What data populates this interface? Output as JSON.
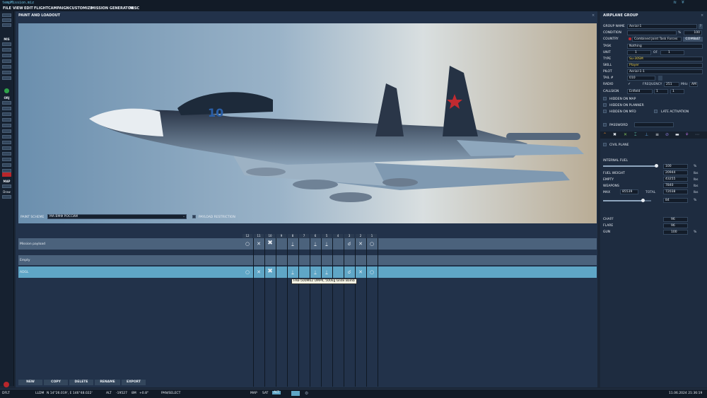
{
  "window": {
    "title": "tempMission.miz"
  },
  "menu": [
    "FILE",
    "VIEW",
    "EDIT",
    "FLIGHT",
    "CAMPAIGN",
    "CUSTOMIZE",
    "MISSION GENERATOR",
    "MISC"
  ],
  "left_toolbar": {
    "labels": [
      "MIS",
      "ORJ",
      "MAP"
    ],
    "map_buttons": [
      "Draw"
    ]
  },
  "loadout_panel": {
    "title": "PAINT AND LOADOUT",
    "paint_scheme_label": "PAINT SCHEME",
    "paint_scheme_value": "МА ВМФ РОССИИ",
    "payload_restriction_label": "PAYLOAD RESTRICTION",
    "stations": [
      "12",
      "11",
      "10",
      "9",
      "8",
      "7",
      "6",
      "5",
      "4",
      "3",
      "2",
      "1"
    ],
    "rows": [
      {
        "name": "Mission payload",
        "selected": false
      },
      {
        "name": "Empty",
        "selected": false
      },
      {
        "name": "ADGL",
        "selected": true
      }
    ],
    "tooltip": "FAB-500M62 UMPK, 500kg Glide Bomb",
    "buttons": [
      "NEW",
      "COPY",
      "DELETE",
      "RENAME",
      "EXPORT"
    ]
  },
  "group_panel": {
    "title": "AIRPLANE GROUP",
    "group_name_label": "GROUP NAME",
    "group_name": "Aerial-1",
    "condition_label": "CONDITION",
    "condition_value": "100",
    "country_label": "COUNTRY",
    "country": "Combined Joint Task Forces",
    "combat_btn": "COMBAT",
    "task_label": "TASK",
    "task": "Nothing",
    "unit_label": "UNIT",
    "unit": "1",
    "of_label": "OF",
    "of_value": "1",
    "type_label": "TYPE",
    "type": "Su-30SM",
    "skill_label": "SKILL",
    "skill": "Player",
    "pilot_label": "PILOT",
    "pilot": "Aerial-1-1",
    "tail_label": "TAIL #",
    "tail": "010",
    "radio_label": "RADIO",
    "frequency_label": "FREQUENCY",
    "frequency": "251",
    "mhz": "MHz",
    "am": "AM",
    "callsign_label": "CALLSIGN",
    "callsign": "Enfield",
    "callsign_n1": "1",
    "callsign_n2": "1",
    "hidden_map": "HIDDEN ON MAP",
    "hidden_planner": "HIDDEN ON PLANNER",
    "hidden_mfd": "HIDDEN ON MFD",
    "late_activation": "LATE ACTIVATION",
    "password_label": "PASSWORD",
    "civil_plane": "CIVIL PLANE",
    "internal_fuel_label": "INTERNAL FUEL",
    "internal_fuel": "100",
    "pct": "%",
    "fuel_weight_label": "FUEL WEIGHT",
    "fuel_weight": "20944",
    "empty_label": "EMPTY",
    "empty": "43255",
    "weapons_label": "WEAPONS",
    "weapons": "7840",
    "max_label": "MAX",
    "max": "85539",
    "total_label": "TOTAL",
    "total": "72038",
    "slider2_value": "84",
    "lbs": "lbs",
    "chaff_label": "CHAFF",
    "chaff": "96",
    "flare_label": "FLARE",
    "flare": "96",
    "gun_label": "GUN",
    "gun": "100",
    "fuel_slider_level": 1.0,
    "slider2_level": 0.84
  },
  "status": {
    "mode": "DFLT",
    "coord_type": "LLDM",
    "coords": "N 14°26.019', E 146°48.022'",
    "alt_label": "ALT",
    "alt": "-19527",
    "bm": "8M",
    "bm_value": "+0.8°",
    "tool": "PAN/SELECT",
    "map_btn": "MAP",
    "sat_btn": "SAT",
    "alt_btn": "ALT",
    "datetime": "11.06.2024 21:36:19"
  },
  "colors": {
    "accent": "#5fa6c6",
    "selected_row": "#5fa6c6",
    "panel": "#22324a"
  }
}
